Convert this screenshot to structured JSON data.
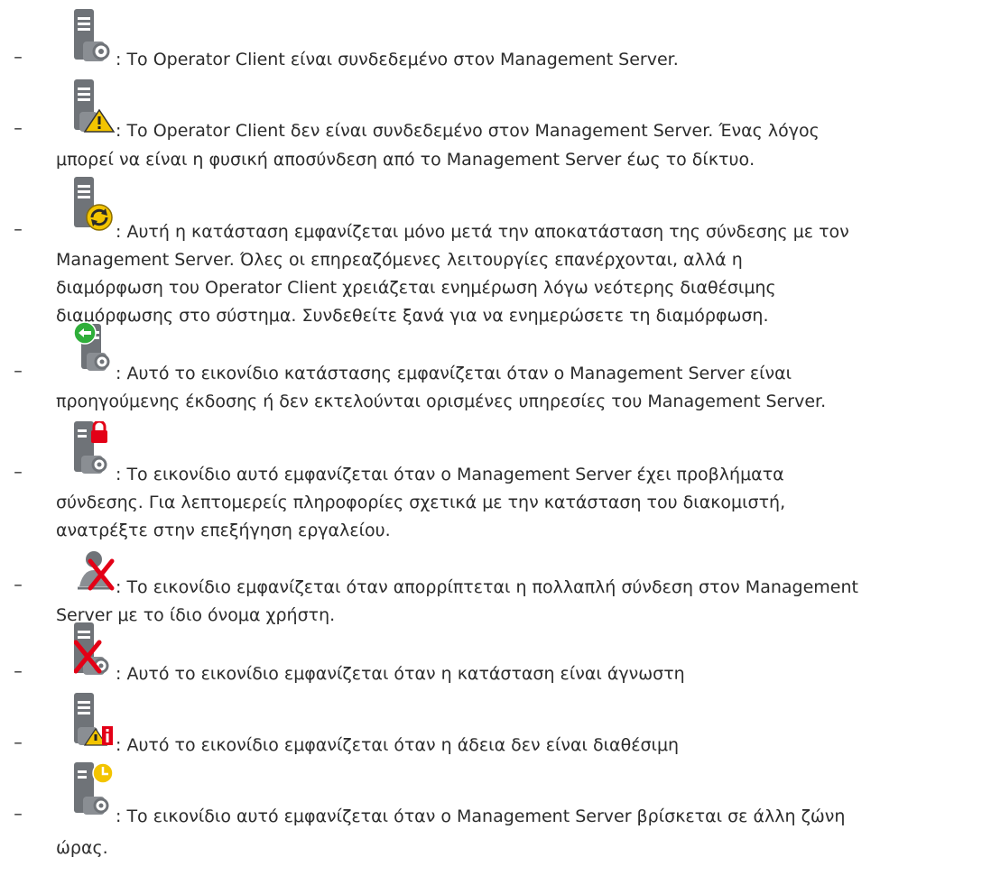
{
  "page": {
    "bullet": "–",
    "items": [
      {
        "icon": "server-connected-icon",
        "lines": [
          "Το Operator Client είναι συνδεδεμένο στον Management Server."
        ]
      },
      {
        "icon": "server-warning-icon",
        "lines": [
          "Το Operator Client δεν είναι συνδεδεμένο στον Management Server. Ένας λόγος",
          "μπορεί να είναι η φυσική αποσύνδεση από το Management Server έως το δίκτυο."
        ]
      },
      {
        "icon": "server-refresh-icon",
        "lines": [
          "Αυτή η κατάσταση εμφανίζεται μόνο μετά την αποκατάσταση της σύνδεσης με τον",
          "Management Server. Όλες οι επηρεαζόμενες λειτουργίες επανέρχονται, αλλά η",
          "διαμόρφωση του Operator Client χρειάζεται ενημέρωση λόγω νεότερης διαθέσιμης",
          "διαμόρφωσης στο σύστημα. Συνδεθείτε ξανά για να ενημερώσετε τη διαμόρφωση."
        ]
      },
      {
        "icon": "server-older-version-icon",
        "lines": [
          "Αυτό το εικονίδιο κατάστασης εμφανίζεται όταν ο Management Server είναι",
          "προηγούμενης έκδοσης ή δεν εκτελούνται ορισμένες υπηρεσίες του Management Server."
        ]
      },
      {
        "icon": "server-lock-icon",
        "lines": [
          "Το εικονίδιο αυτό εμφανίζεται όταν ο Management Server έχει προβλήματα",
          "σύνδεσης. Για λεπτομερείς πληροφορίες σχετικά με την κατάσταση του διακομιστή,",
          "ανατρέξτε στην επεξήγηση εργαλείου."
        ]
      },
      {
        "icon": "user-rejected-icon",
        "lines": [
          "Το εικονίδιο εμφανίζεται όταν απορρίπτεται η πολλαπλή σύνδεση στον Management",
          "Server με το ίδιο όνομα χρήστη."
        ]
      },
      {
        "icon": "server-unknown-icon",
        "lines": [
          "Αυτό το εικονίδιο εμφανίζεται όταν η κατάσταση είναι άγνωστη"
        ]
      },
      {
        "icon": "server-license-icon",
        "lines": [
          "Αυτό το εικονίδιο εμφανίζεται όταν η άδεια δεν είναι διαθέσιμη"
        ]
      },
      {
        "icon": "server-timezone-icon",
        "lines": [
          "Το εικονίδιο αυτό εμφανίζεται όταν ο Management Server βρίσκεται σε άλλη ζώνη",
          "ώρας."
        ]
      }
    ]
  }
}
